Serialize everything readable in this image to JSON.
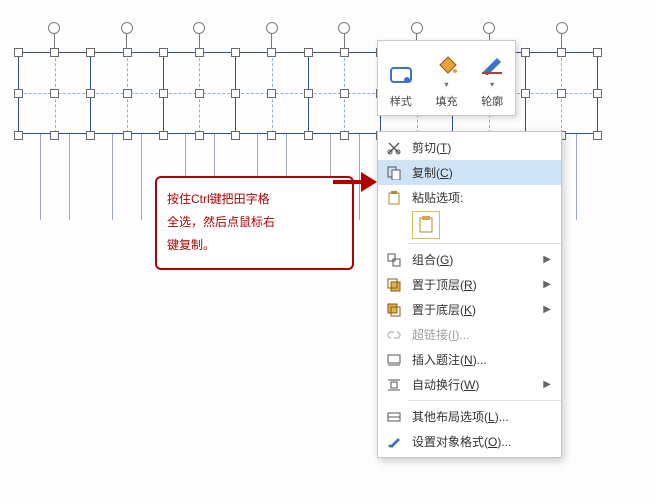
{
  "grid": {
    "cells": 8
  },
  "callout": {
    "line1": "按住Ctrl键把田字格",
    "line2": "全选，然后点鼠标右",
    "line3": "键复制。"
  },
  "minibar": {
    "style": "样式",
    "fill": "填充",
    "outline": "轮廓"
  },
  "menu": {
    "cut": {
      "label": "剪切",
      "accel": "T"
    },
    "copy": {
      "label": "复制",
      "accel": "C"
    },
    "pasteOpts": {
      "label": "粘贴选项:"
    },
    "group": {
      "label": "组合",
      "accel": "G"
    },
    "bringFront": {
      "label": "置于顶层",
      "accel": "R"
    },
    "sendBack": {
      "label": "置于底层",
      "accel": "K"
    },
    "hyperlink": {
      "label": "超链接",
      "accel": "I"
    },
    "caption": {
      "label": "插入题注",
      "accel": "N"
    },
    "wrap": {
      "label": "自动换行",
      "accel": "W"
    },
    "layout": {
      "label": "其他布局选项",
      "accel": "L"
    },
    "format": {
      "label": "设置对象格式",
      "accel": "O"
    }
  }
}
